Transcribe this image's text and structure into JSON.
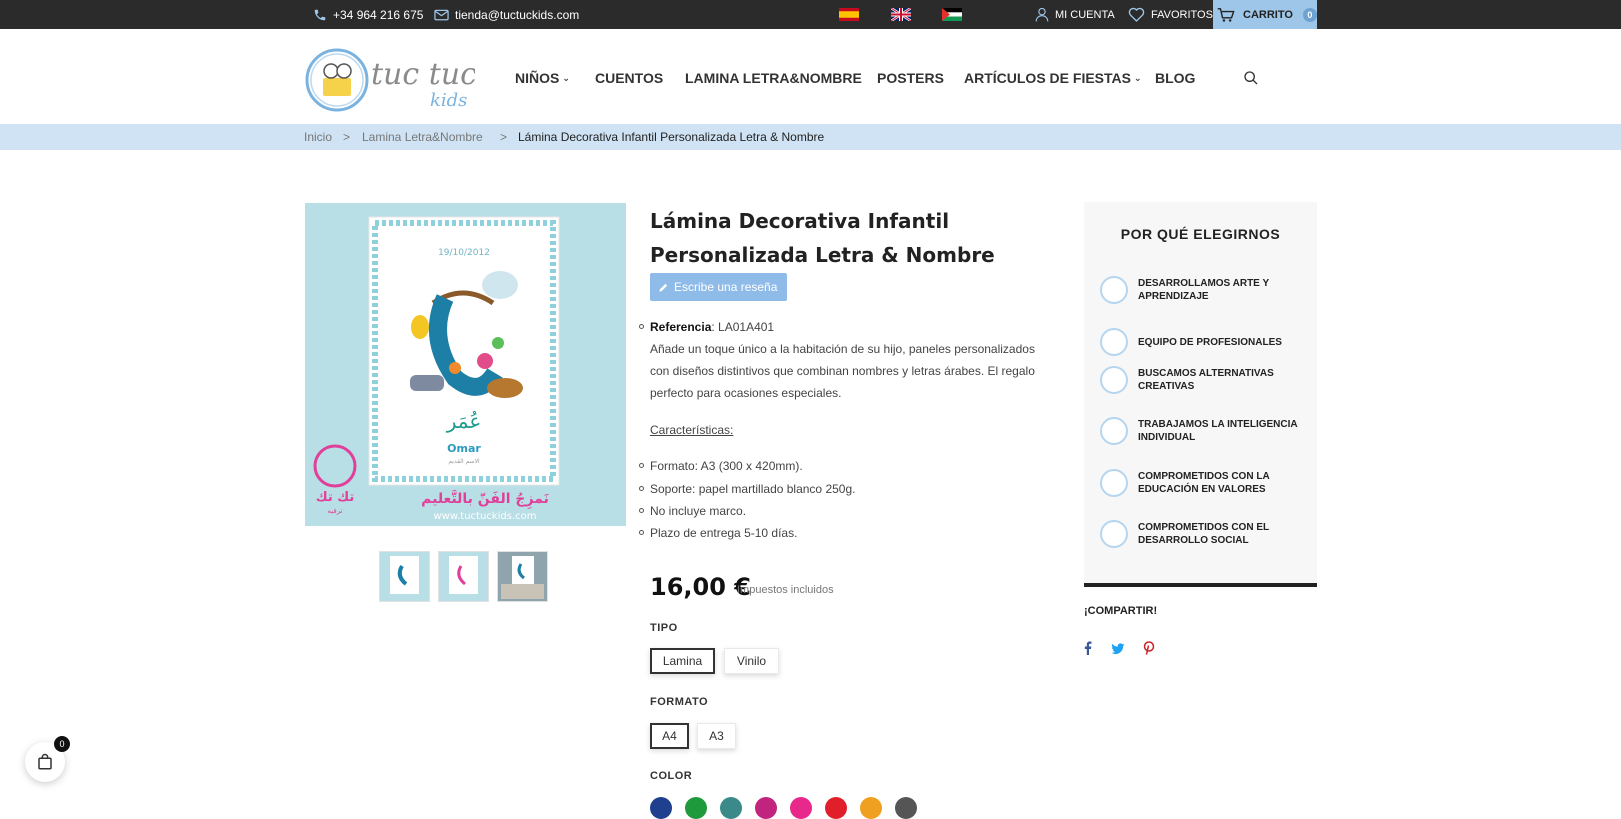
{
  "topbar": {
    "phone": "+34 964 216 675",
    "email": "tienda@tuctuckids.com",
    "account": "MI CUENTA",
    "favorites": "FAVORITOS",
    "cart": "CARRITO",
    "cart_count": "0",
    "flags": [
      "spain-flag",
      "uk-flag",
      "palestine-flag"
    ]
  },
  "logo": {
    "line1": "tuc tuc",
    "line2": "kids"
  },
  "nav": [
    {
      "label": "NIÑOS",
      "dropdown": true
    },
    {
      "label": "CUENTOS",
      "dropdown": false
    },
    {
      "label": "LAMINA LETRA&NOMBRE",
      "dropdown": false
    },
    {
      "label": "POSTERS",
      "dropdown": false
    },
    {
      "label": "ARTÍCULOS DE FIESTAS",
      "dropdown": true
    },
    {
      "label": "BLOG",
      "dropdown": false
    }
  ],
  "breadcrumb": {
    "home": "Inicio",
    "sep": ">",
    "category": "Lamina Letra&Nombre",
    "current": "Lámina Decorativa Infantil Personalizada Letra & Nombre"
  },
  "product": {
    "title_line1": "Lámina Decorativa Infantil",
    "title_line2": "Personalizada Letra & Nombre",
    "review_button": "Escribe una reseña",
    "ref_label": "Referencia",
    "ref_value": ": LA01A401",
    "desc_lines": [
      "Añade un toque único a la habitación de su hijo, paneles personalizados",
      "con diseños distintivos que combinan nombres y letras árabes. El regalo",
      "perfecto para ocasiones especiales."
    ],
    "features_heading": "Características:",
    "features": [
      "Formato: A3 (300 x 420mm).",
      "Soporte: papel martillado blanco 250g.",
      "No incluye marco.",
      "Plazo de entrega 5-10 días."
    ],
    "price": "16,00 €",
    "tax_note": "Impuestos incluidos",
    "image": {
      "date": "19/10/2012",
      "arabic_name": "عُمَر",
      "name": "Omar",
      "subtitle": "الاسم القديم",
      "slogan": "نَمزِجُ الفَنّ بالتَّعليم",
      "url": "www.tuctuckids.com",
      "brand_arabic": "تك تك",
      "brand_sub": "ترفيه"
    }
  },
  "options": {
    "tipo_label": "TIPO",
    "tipo": [
      "Lamina",
      "Vinilo"
    ],
    "tipo_selected": "Lamina",
    "formato_label": "FORMATO",
    "formato": [
      "A4",
      "A3"
    ],
    "formato_selected": "A4",
    "color_label": "COLOR",
    "colors": [
      "#1f3f8f",
      "#1e9a3c",
      "#3a8a8a",
      "#c0247e",
      "#e8288a",
      "#e01f2a",
      "#f0a020",
      "#555555"
    ]
  },
  "why": {
    "title": "POR QUÉ ELEGIRNOS",
    "items": [
      [
        "DESARROLLAMOS ARTE Y",
        "APRENDIZAJE"
      ],
      [
        "EQUIPO DE PROFESIONALES"
      ],
      [
        "BUSCAMOS ALTERNATIVAS",
        "CREATIVAS"
      ],
      [
        "TRABAJAMOS LA INTELIGENCIA",
        "INDIVIDUAL"
      ],
      [
        "COMPROMETIDOS CON LA",
        "EDUCACIÓN EN VALORES"
      ],
      [
        "COMPROMETIDOS CON EL",
        "DESARROLLO SOCIAL"
      ]
    ]
  },
  "share": {
    "label": "¡COMPARTIR!",
    "colors": {
      "facebook": "#3b5998",
      "twitter": "#1da1f2",
      "pinterest": "#cb2027"
    }
  },
  "floating_cart": {
    "count": "0"
  }
}
